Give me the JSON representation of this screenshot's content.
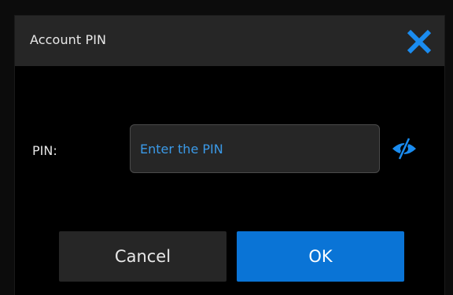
{
  "dialog": {
    "title": "Account PIN",
    "close_icon": "close-icon",
    "accent_color": "#0a74d6"
  },
  "form": {
    "pin_label": "PIN:",
    "pin_value": "",
    "pin_placeholder": "Enter the PIN",
    "visibility_icon": "eye-slash-icon"
  },
  "buttons": {
    "cancel_label": "Cancel",
    "ok_label": "OK"
  }
}
